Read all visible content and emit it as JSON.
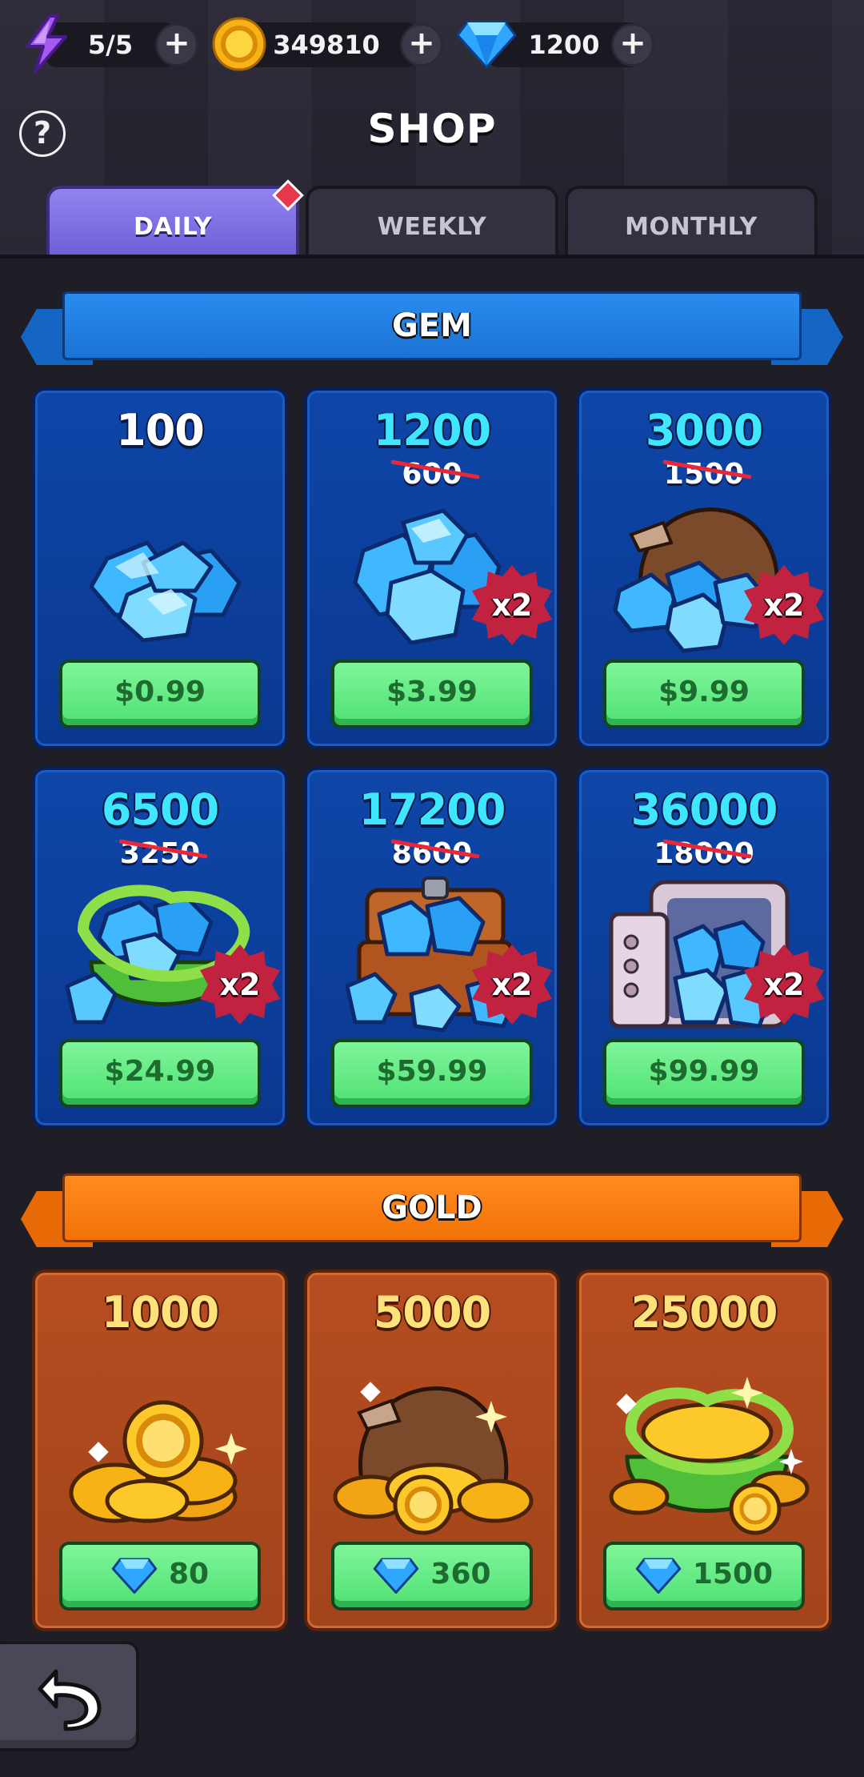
{
  "resources": {
    "energy": "5/5",
    "coins": "349810",
    "gems": "1200"
  },
  "header": {
    "title": "SHOP",
    "help": "?"
  },
  "tabs": [
    {
      "label": "DAILY",
      "active": true
    },
    {
      "label": "WEEKLY",
      "active": false
    },
    {
      "label": "MONTHLY",
      "active": false
    }
  ],
  "sections": {
    "gem": {
      "title": "GEM",
      "color": "#1e7ce0",
      "items": [
        {
          "amount": "100",
          "old": "",
          "bonus": "",
          "price": "$0.99",
          "art": "gem-pile-icon"
        },
        {
          "amount": "1200",
          "old": "600",
          "bonus": "x2",
          "price": "$3.99",
          "art": "gem-pile-icon"
        },
        {
          "amount": "3000",
          "old": "1500",
          "bonus": "x2",
          "price": "$9.99",
          "art": "gem-sack-icon"
        },
        {
          "amount": "6500",
          "old": "3250",
          "bonus": "x2",
          "price": "$24.99",
          "art": "gem-basket-icon"
        },
        {
          "amount": "17200",
          "old": "8600",
          "bonus": "x2",
          "price": "$59.99",
          "art": "gem-chest-icon"
        },
        {
          "amount": "36000",
          "old": "18000",
          "bonus": "x2",
          "price": "$99.99",
          "art": "gem-vault-icon"
        }
      ]
    },
    "gold": {
      "title": "GOLD",
      "color": "#ff7a0a",
      "items": [
        {
          "amount": "1000",
          "price": "80",
          "art": "coin-pile-icon"
        },
        {
          "amount": "5000",
          "price": "360",
          "art": "coin-sack-icon"
        },
        {
          "amount": "25000",
          "price": "1500",
          "art": "coin-basket-icon"
        }
      ]
    }
  },
  "colors": {
    "accent_tab": "#7c6de0",
    "buy_button": "#5ee97f",
    "badge": "#c0223f",
    "gem_amount": "#3ee6ff"
  }
}
